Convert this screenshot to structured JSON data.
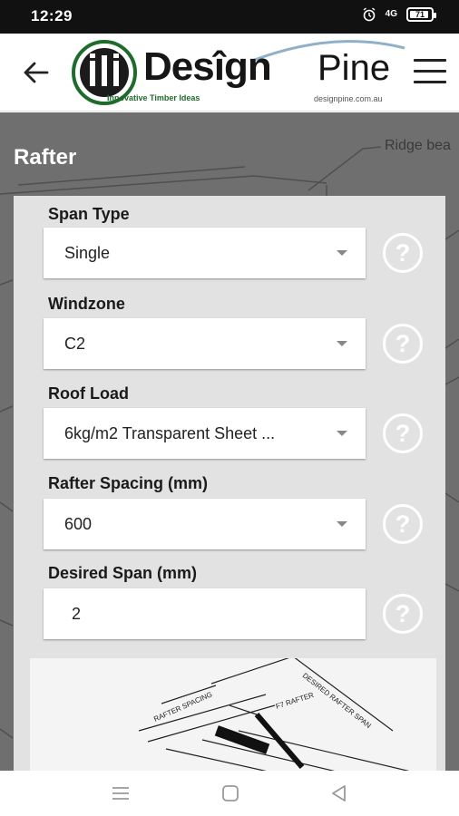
{
  "status": {
    "time": "12:29",
    "battery": "71",
    "signal": "4G"
  },
  "header": {
    "logo_word_bold": "Desîgn",
    "logo_word_light": "Pine",
    "logo_tagline": "Innovative Timber Ideas",
    "logo_url": "designpine.com.au"
  },
  "page": {
    "title": "Rafter",
    "background_label": "Ridge bea"
  },
  "form": {
    "span_type": {
      "label": "Span Type",
      "value": "Single"
    },
    "windzone": {
      "label": "Windzone",
      "value": "C2"
    },
    "roof_load": {
      "label": "Roof Load",
      "value": "6kg/m2 Transparent Sheet ..."
    },
    "rafter_spacing": {
      "label": "Rafter Spacing (mm)",
      "value": "600"
    },
    "desired_span": {
      "label": "Desired Span (mm)",
      "value": "2"
    },
    "help_glyph": "?"
  },
  "diagram": {
    "label_spacing": "RAFTER SPACING",
    "label_span": "DESIRED RAFTER SPAN",
    "label_rafter": "F7 RAFTER"
  },
  "colors": {
    "brand_green": "#1f6b2c",
    "card_bg": "#e2e2e2",
    "backdrop": "#6f6f6f"
  }
}
